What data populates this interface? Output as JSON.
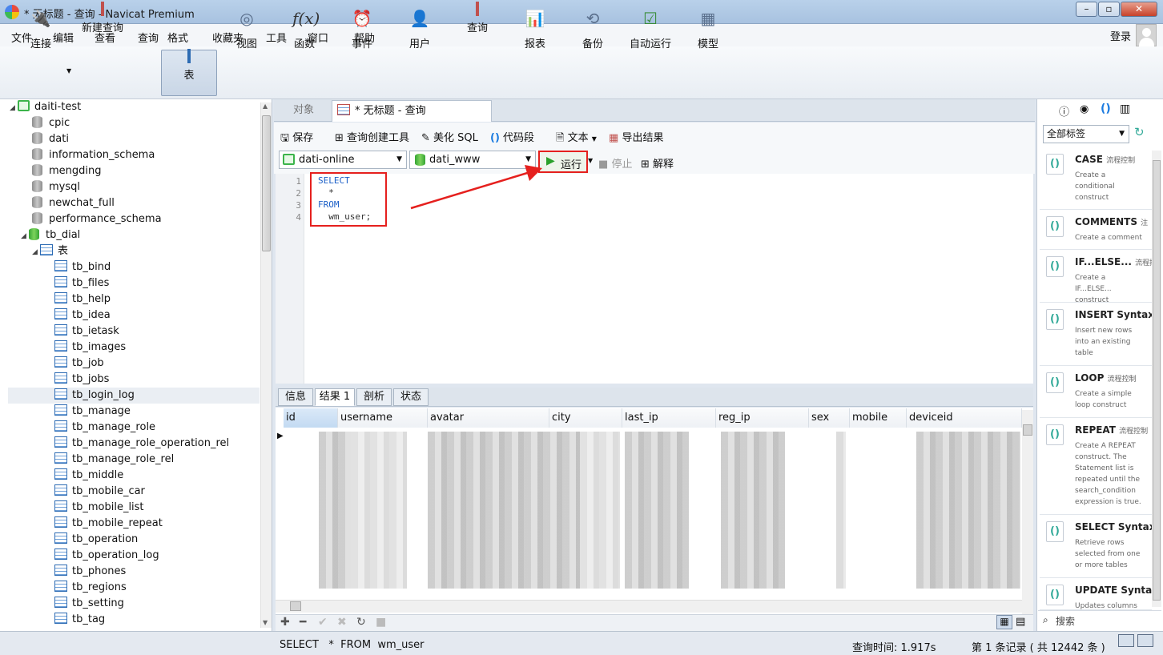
{
  "window": {
    "title": "* 无标题 - 查询 - Navicat Premium"
  },
  "menu": [
    "文件",
    "编辑",
    "查看",
    "查询",
    "格式",
    "收藏夹",
    "工具",
    "窗口",
    "帮助"
  ],
  "login_label": "登录",
  "toolbar": [
    {
      "label": "连接",
      "icon": "plug-icon"
    },
    {
      "label": "新建查询",
      "icon": "new-query-icon"
    },
    {
      "label": "表",
      "icon": "table-icon"
    },
    {
      "label": "视图",
      "icon": "view-icon"
    },
    {
      "label": "函数",
      "icon": "function-icon",
      "glyph": "f(x)"
    },
    {
      "label": "事件",
      "icon": "clock-icon"
    },
    {
      "label": "用户",
      "icon": "user-icon"
    },
    {
      "label": "查询",
      "icon": "query-icon"
    },
    {
      "label": "报表",
      "icon": "report-icon"
    },
    {
      "label": "备份",
      "icon": "backup-icon"
    },
    {
      "label": "自动运行",
      "icon": "schedule-icon"
    },
    {
      "label": "模型",
      "icon": "model-icon"
    }
  ],
  "sidebar": {
    "connection": "daiti-test",
    "databases": [
      "cpic",
      "dati",
      "information_schema",
      "mengding",
      "mysql",
      "newchat_full",
      "performance_schema"
    ],
    "open_db": "tb_dial",
    "tables_node": "表",
    "tables": [
      "tb_bind",
      "tb_files",
      "tb_help",
      "tb_idea",
      "tb_ietask",
      "tb_images",
      "tb_job",
      "tb_jobs",
      "tb_login_log",
      "tb_manage",
      "tb_manage_role",
      "tb_manage_role_operation_rel",
      "tb_manage_role_rel",
      "tb_middle",
      "tb_mobile_car",
      "tb_mobile_list",
      "tb_mobile_repeat",
      "tb_operation",
      "tb_operation_log",
      "tb_phones",
      "tb_regions",
      "tb_setting",
      "tb_tag"
    ]
  },
  "tabs": {
    "objects": "对象",
    "query": "* 无标题 - 查询"
  },
  "query_toolbar": {
    "save": "保存",
    "builder": "查询创建工具",
    "beautify": "美化 SQL",
    "snippet": "代码段",
    "text": "文本",
    "export": "导出结果"
  },
  "query_toolbar2": {
    "connection": "dati-online",
    "database": "dati_www",
    "run": "运行",
    "stop": "停止",
    "explain": "解释"
  },
  "editor": {
    "line_numbers": [
      "1",
      "2",
      "3",
      "4"
    ],
    "lines": [
      "SELECT",
      "  *",
      "FROM",
      "  wm_user;"
    ]
  },
  "result_tabs": [
    "信息",
    "结果 1",
    "剖析",
    "状态"
  ],
  "grid_columns": [
    "id",
    "username",
    "avatar",
    "city",
    "last_ip",
    "reg_ip",
    "sex",
    "mobile",
    "deviceid"
  ],
  "right_panel": {
    "filter": "全部标签",
    "search_placeholder": "搜索",
    "snippets": [
      {
        "title": "CASE",
        "tag": "流程控制",
        "desc": "Create a conditional construct"
      },
      {
        "title": "COMMENTS",
        "tag": "注",
        "desc": "Create a comment"
      },
      {
        "title": "IF...ELSE...",
        "tag": "流程控",
        "desc": "Create a IF...ELSE... construct"
      },
      {
        "title": "INSERT Syntax",
        "tag": "",
        "desc": "Insert new rows into an existing table"
      },
      {
        "title": "LOOP",
        "tag": "流程控制",
        "desc": "Create a simple loop construct"
      },
      {
        "title": "REPEAT",
        "tag": "流程控制",
        "desc": "Create A REPEAT construct. The Statement list is repeated until the search_condition expression is true."
      },
      {
        "title": "SELECT Syntax",
        "tag": "",
        "desc": "Retrieve rows selected from one or more tables"
      },
      {
        "title": "UPDATE Syntax",
        "tag": "",
        "desc": "Updates columns"
      }
    ]
  },
  "status": {
    "sql": "SELECT   *  FROM  wm_user",
    "query_time": "查询时间: 1.917s",
    "records": "第 1 条记录 ( 共 12442 条 )"
  }
}
